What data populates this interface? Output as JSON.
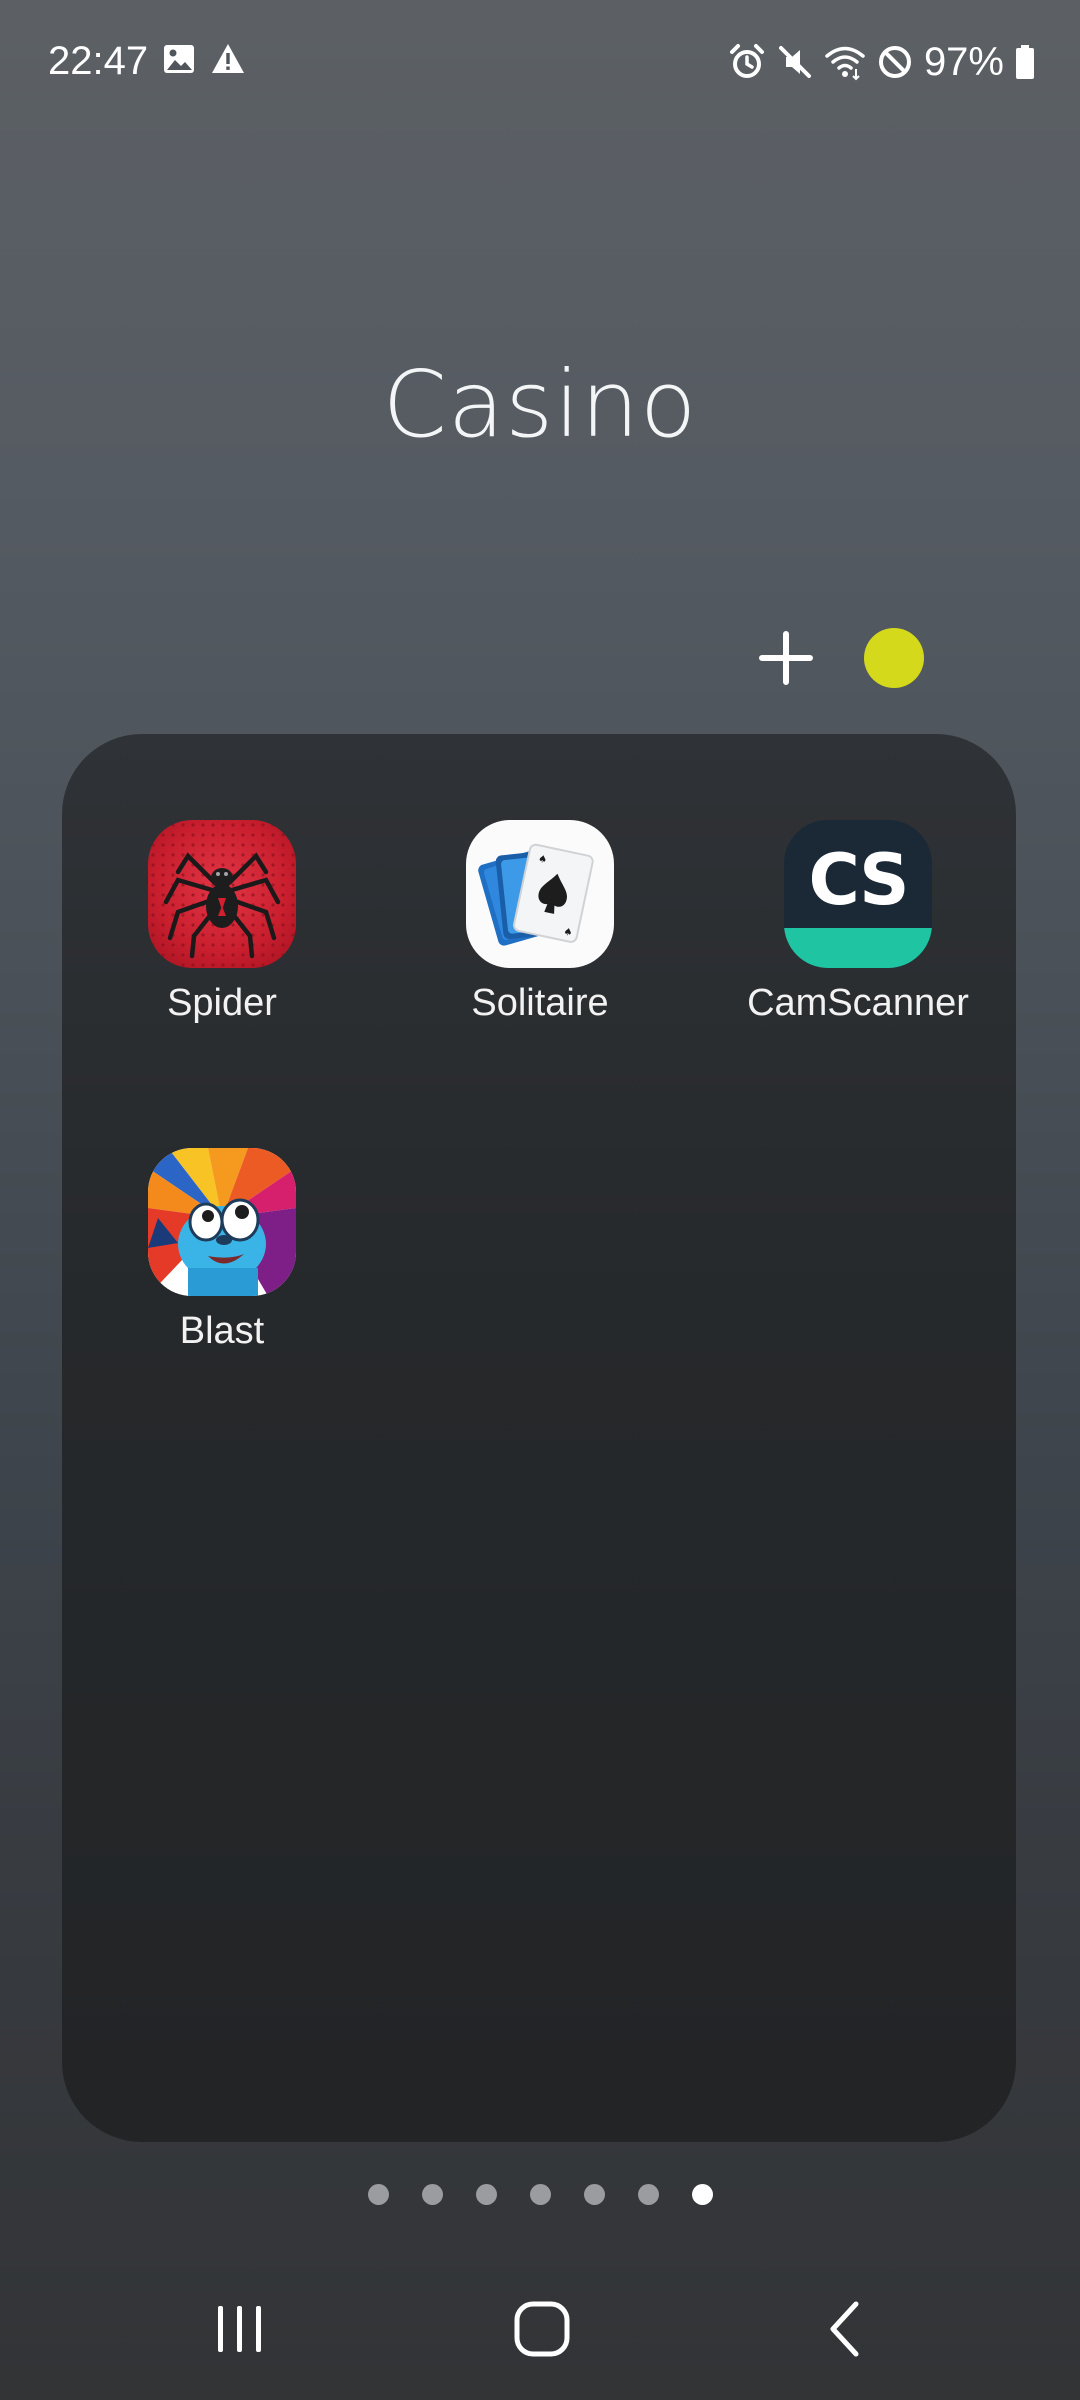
{
  "status_bar": {
    "time": "22:47",
    "battery": "97%",
    "left_icons": [
      "image-icon",
      "warning-icon"
    ],
    "right_icons": [
      "alarm-icon",
      "mute-icon",
      "wifi-icon",
      "do-not-disturb-icon",
      "battery-icon"
    ]
  },
  "folder": {
    "title": "Casino",
    "accent_color": "#d4d91c",
    "apps": [
      {
        "label": "Spider",
        "icon": "spider-solitaire-icon"
      },
      {
        "label": "Solitaire",
        "icon": "solitaire-cards-icon"
      },
      {
        "label": "CamScanner",
        "icon": "camscanner-icon",
        "icon_text": "CS"
      },
      {
        "label": "Blast",
        "icon": "blast-game-icon"
      }
    ]
  },
  "pagination": {
    "total_pages": 7,
    "active_page": 7
  },
  "nav": {
    "buttons": [
      "recent-apps-button",
      "home-button",
      "back-button"
    ]
  }
}
